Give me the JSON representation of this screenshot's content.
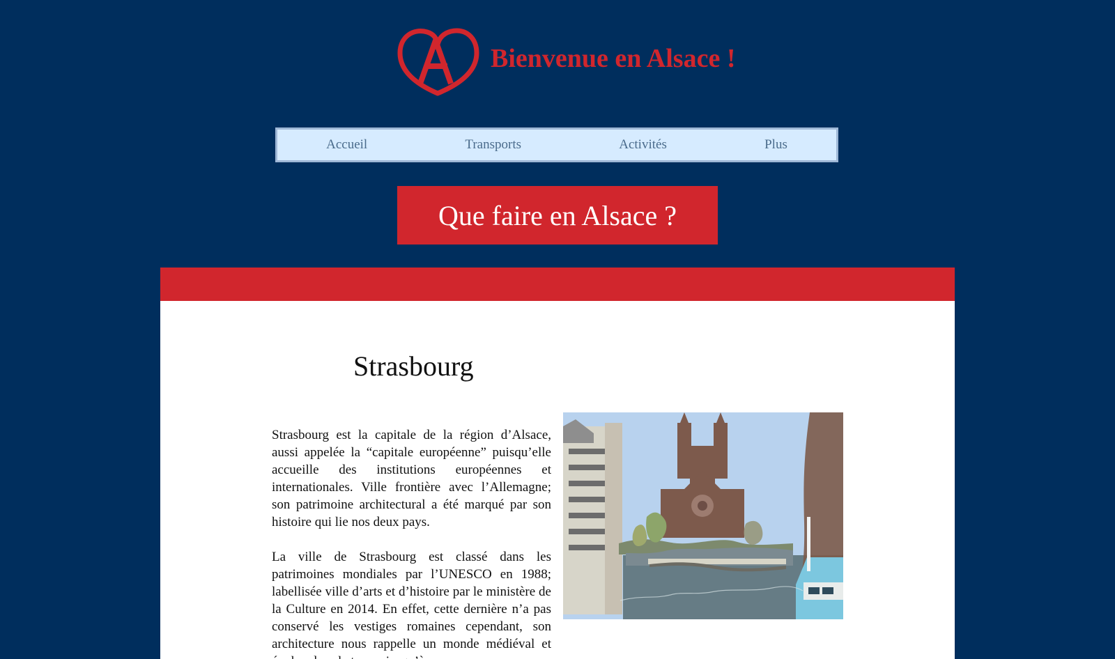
{
  "header": {
    "title": "Bienvenue en Alsace !",
    "logo_icon": "alsace-logo-icon",
    "brand_color": "#d1262d",
    "background_color": "#002e5d"
  },
  "nav": {
    "items": [
      {
        "label": "Accueil"
      },
      {
        "label": "Transports"
      },
      {
        "label": "Activités"
      },
      {
        "label": "Plus"
      }
    ],
    "background_color": "#d6ebff"
  },
  "hero": {
    "label": "Que faire en Alsace ?",
    "background_color": "#d1262d"
  },
  "content": {
    "title": "Strasbourg",
    "paragraphs": [
      "Strasbourg est la capitale de la région d’Alsace, aussi appelée la “capitale européenne” puisqu’elle accueille des institutions européennes et internationales. Ville frontière avec l’Allemagne; son patrimoine architectural a été marqué par son histoire qui lie nos deux pays.",
      "La ville de Strasbourg est classé dans les patrimoines mondiales par l’UNESCO en 1988; labellisée ville d’arts et d’histoire par le ministère de la Culture en 2014. En effet, cette dernière n’a pas conservé les vestiges romaines cependant, son architecture nous rappelle un monde médiéval et évolue dans le temps jusqu’à"
    ],
    "image": {
      "subject": "church-image",
      "caption": ""
    }
  }
}
